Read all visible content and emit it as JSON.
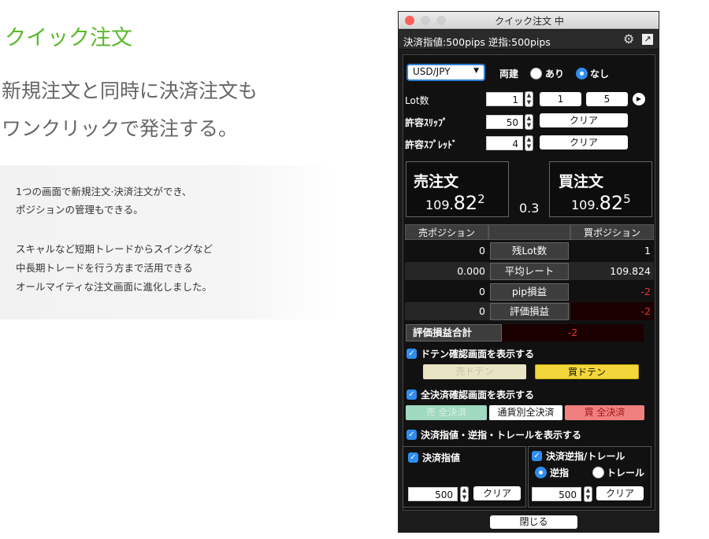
{
  "promo": {
    "title": "クイック注文",
    "headline_1": "新規注文と同時に決済注文も",
    "headline_2": "ワンクリックで発注する。",
    "para1_line1": "1つの画面で新規注文·決済注文ができ、",
    "para1_line2": "ポジションの管理もできる。",
    "para2_line1": "スキャルなど短期トレードからスイングなど",
    "para2_line2": "中長期トレードを行う方まで活用できる",
    "para2_line3": "オールマイティな注文画面に進化しました。"
  },
  "window": {
    "title": "クイック注文 中",
    "subtitle": "決済指値:500pips 逆指:500pips",
    "currency_pair": "USD/JPY",
    "both_label": "両建",
    "both_yes": "あり",
    "both_no": "なし",
    "lot_label": "Lot数",
    "lot_value": "1",
    "lot_preset_1": "1",
    "lot_preset_2": "5",
    "slippage_label": "許容ｽﾘｯﾌﾟ",
    "slippage_value": "50",
    "spread_label": "許容ｽﾌﾟﾚｯﾄﾞ",
    "spread_value": "4",
    "clear_label": "クリア",
    "sell_label": "売注文",
    "sell_price_main": "109.",
    "sell_price_big": "82",
    "sell_price_pip": "2",
    "buy_label": "買注文",
    "buy_price_main": "109.",
    "buy_price_big": "82",
    "buy_price_pip": "5",
    "spread_display": "0.3",
    "table": {
      "sell_header": "売ポジション",
      "buy_header": "買ポジション",
      "rows": [
        {
          "sell": "0",
          "label": "残Lot数",
          "buy": "1"
        },
        {
          "sell": "0.000",
          "label": "平均レート",
          "buy": "109.824"
        },
        {
          "sell": "0",
          "label": "pip損益",
          "buy": "-2"
        },
        {
          "sell": "0",
          "label": "評価損益",
          "buy": "-2"
        }
      ],
      "total_label": "評価損益合計",
      "total_value": "-2"
    },
    "doten_check_label": "ドテン確認画面を表示する",
    "sell_doten": "売ドテン",
    "buy_doten": "買ドテン",
    "close_all_check_label": "全決済確認画面を表示する",
    "sell_close_all": "売 全決済",
    "currency_close_all": "通貨別全決済",
    "buy_close_all": "買 全決済",
    "show_limit_stop_label": "決済指値・逆指・トレールを表示する",
    "limit_label": "決済指値",
    "stop_trail_label": "決済逆指/トレール",
    "stop_radio": "逆指",
    "trail_radio": "トレール",
    "limit_value": "500",
    "stop_value": "500",
    "close_button": "閉じる"
  },
  "colors": {
    "accent_green": "#5cb82e",
    "blue": "#2f8df0",
    "red": "#e53434",
    "buy_yellow": "#f3d63a",
    "sell_yellow_disabled": "#e8e4c4",
    "sell_green_disabled": "#9fd9bf",
    "buy_red": "#f08080"
  }
}
